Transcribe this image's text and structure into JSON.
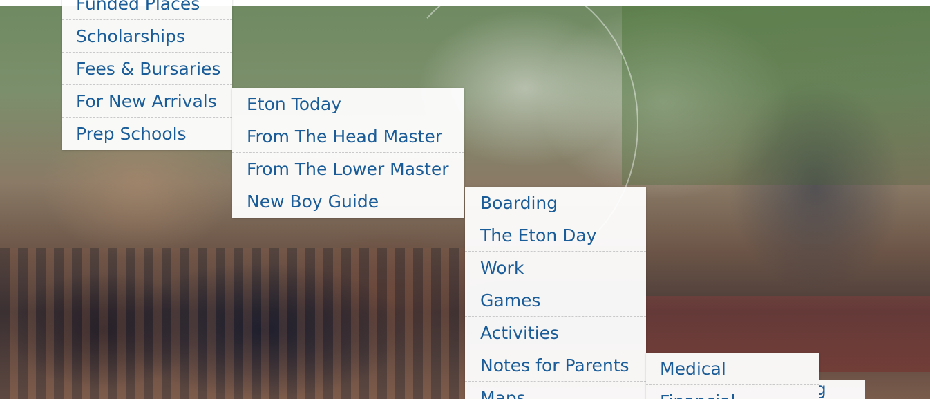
{
  "menus": {
    "level1": {
      "items": [
        {
          "label": "Funded Places"
        },
        {
          "label": "Scholarships"
        },
        {
          "label": "Fees & Bursaries"
        },
        {
          "label": "For New Arrivals"
        },
        {
          "label": "Prep Schools"
        }
      ]
    },
    "level2": {
      "items": [
        {
          "label": "Eton Today"
        },
        {
          "label": "From The Head Master"
        },
        {
          "label": "From The Lower Master"
        },
        {
          "label": "New Boy Guide"
        }
      ]
    },
    "level3": {
      "items": [
        {
          "label": "Boarding"
        },
        {
          "label": "The Eton Day"
        },
        {
          "label": "Work"
        },
        {
          "label": "Games"
        },
        {
          "label": "Activities"
        },
        {
          "label": "Notes for Parents"
        },
        {
          "label": "Maps"
        }
      ]
    },
    "level4": {
      "items": [
        {
          "label": "Medical"
        },
        {
          "label": "Financial"
        }
      ]
    },
    "partial_item": {
      "label": "ng"
    }
  },
  "colors": {
    "link": "#1a5c97",
    "menu_bg": "#ffffff",
    "divider": "#c9c9c9"
  }
}
